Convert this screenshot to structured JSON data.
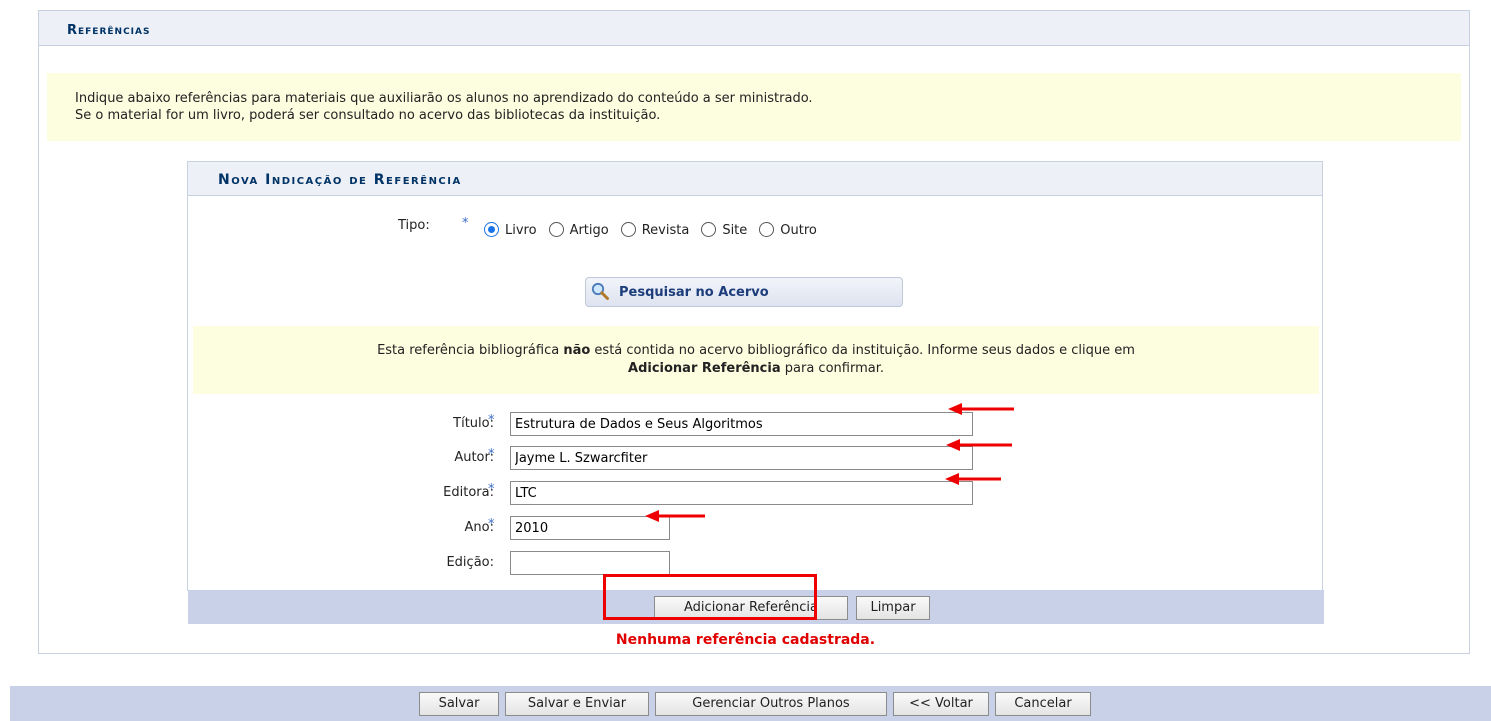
{
  "outer_panel": {
    "title": "Referências"
  },
  "info": {
    "line1": "Indique abaixo referências para materiais que auxiliarão os alunos no aprendizado do conteúdo a ser ministrado.",
    "line2": "Se o material for um livro, poderá ser consultado no acervo das bibliotecas da instituição."
  },
  "inner_panel": {
    "title": "Nova Indicação de Referência"
  },
  "tipo": {
    "label": "Tipo:",
    "required": "*",
    "options": [
      "Livro",
      "Artigo",
      "Revista",
      "Site",
      "Outro"
    ],
    "selected": "Livro"
  },
  "search_button": {
    "label": "Pesquisar no Acervo",
    "icon": "magnifier-icon"
  },
  "warning": {
    "prefix": "Esta referência bibliográfica ",
    "bold1": "não",
    "middle": " está contida no acervo bibliográfico da instituição. Informe seus dados e clique em",
    "bold2": "Adicionar Referência",
    "suffix": " para confirmar."
  },
  "fields": {
    "titulo": {
      "label": "Título:",
      "value": "Estrutura de Dados e Seus Algoritmos"
    },
    "autor": {
      "label": "Autor:",
      "value": "Jayme L. Szwarcfiter"
    },
    "editora": {
      "label": "Editora:",
      "value": "LTC"
    },
    "ano": {
      "label": "Ano:",
      "value": "2010"
    },
    "edicao": {
      "label": "Edição:",
      "value": ""
    }
  },
  "required_mark": "*",
  "form_buttons": {
    "add": "Adicionar Referência",
    "clear": "Limpar"
  },
  "empty_message": "Nenhuma referência cadastrada.",
  "bottom_buttons": {
    "save": "Salvar",
    "save_send": "Salvar e Enviar",
    "manage": "Gerenciar Outros Planos",
    "back": "<< Voltar",
    "cancel": "Cancelar"
  },
  "colors": {
    "accent": "#003366",
    "error": "#e00000",
    "annotation": "#e00000"
  }
}
